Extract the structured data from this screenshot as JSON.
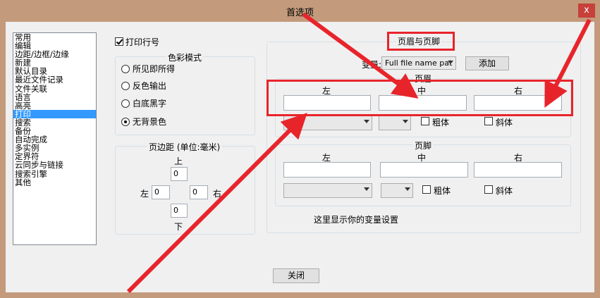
{
  "window": {
    "title": "首选项",
    "close_glyph": "x"
  },
  "categories": [
    "常用",
    "编辑",
    "边距/边框/边缘",
    "新建",
    "默认目录",
    "最近文件记录",
    "文件关联",
    "语言",
    "高亮",
    "打印",
    "搜索",
    "备份",
    "自动完成",
    "多实例",
    "定界符",
    "云同步与链接",
    "搜索引擎",
    "其他"
  ],
  "selected_category": "打印",
  "print": {
    "line_numbers_label": "打印行号",
    "line_numbers_checked": true,
    "color_mode": {
      "title": "色彩模式",
      "options": [
        "所见即所得",
        "反色输出",
        "白底黑字",
        "无背景色"
      ],
      "selected": "无背景色"
    },
    "margins": {
      "title": "页边距 (单位:毫米)",
      "top_label": "上",
      "bottom_label": "下",
      "left_label": "左",
      "right_label": "右",
      "top": "0",
      "bottom": "0",
      "left": "0",
      "right": "0"
    }
  },
  "header_footer": {
    "title": "页眉与页脚",
    "variable_label": "变量:",
    "variable_select": "Full file name pat",
    "add_button": "添加",
    "header": {
      "title": "页眉",
      "left_label": "左",
      "center_label": "中",
      "right_label": "右",
      "left_value": "",
      "center_value": "",
      "right_value": "",
      "bold_label": "粗体",
      "italic_label": "斜体"
    },
    "footer": {
      "title": "页脚",
      "left_label": "左",
      "center_label": "中",
      "right_label": "右",
      "left_value": "",
      "center_value": "",
      "right_value": "",
      "bold_label": "粗体",
      "italic_label": "斜体"
    },
    "hint": "这里显示你的变量设置"
  },
  "close_button": "关闭",
  "annotation_color": "#e8242b"
}
